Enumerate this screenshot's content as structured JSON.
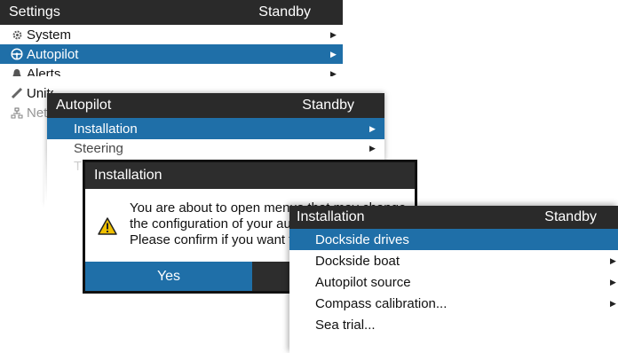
{
  "settings": {
    "title": "Settings",
    "status": "Standby",
    "items": [
      {
        "label": "System",
        "icon": "gear-icon"
      },
      {
        "label": "Autopilot",
        "icon": "steering-wheel-icon"
      },
      {
        "label": "Alerts",
        "icon": "bell-icon"
      },
      {
        "label": "Units",
        "icon": "ruler-icon"
      },
      {
        "label": "Network",
        "icon": "network-icon"
      }
    ]
  },
  "autopilot": {
    "title": "Autopilot",
    "status": "Standby",
    "items": [
      {
        "label": "Installation"
      },
      {
        "label": "Steering"
      },
      {
        "label": "T"
      }
    ]
  },
  "dialog": {
    "title": "Installation",
    "message": [
      "You are about to open menus that may change",
      "the configuration of your autopilot.",
      "Please confirm if you want to continue."
    ],
    "yes_label": "Yes",
    "icon": "warning-icon"
  },
  "installation": {
    "title": "Installation",
    "status": "Standby",
    "items": [
      {
        "label": "Dockside drives"
      },
      {
        "label": "Dockside boat"
      },
      {
        "label": "Autopilot source"
      },
      {
        "label": "Compass calibration..."
      },
      {
        "label": "Sea trial..."
      }
    ]
  },
  "colors": {
    "accent": "#1f6fa8",
    "titlebar": "#2a2a2a",
    "warning": "#f0c000"
  }
}
